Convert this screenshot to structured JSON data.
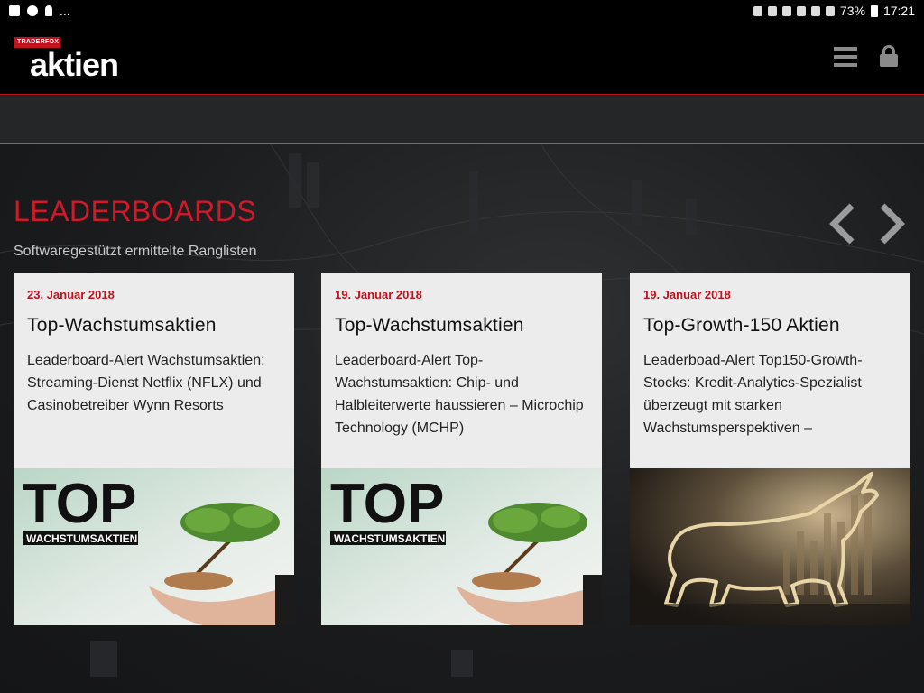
{
  "statusbar": {
    "left_more": "...",
    "battery_percent": "73%",
    "time": "17:21"
  },
  "header": {
    "brand_badge": "TRADERFOX",
    "brand_name": "aktien"
  },
  "section": {
    "title": "LEADERBOARDS",
    "subtitle": "Softwaregestützt ermittelte Ranglisten"
  },
  "cards": [
    {
      "date": "23. Januar 2018",
      "title": "Top-Wachstumsaktien",
      "text": "Leaderboard-Alert Wachstumsaktien: Streaming-Dienst Netflix (NFLX) und Casinobetreiber Wynn Resorts",
      "image_headline": "TOP",
      "image_subline": "WACHSTUMSAKTIEN"
    },
    {
      "date": "19. Januar 2018",
      "title": "Top-Wachstumsaktien",
      "text": "Leaderboard-Alert Top-Wachstumsaktien: Chip- und Halbleiterwerte haussieren – Microchip Technology (MCHP)",
      "image_headline": "TOP",
      "image_subline": "WACHSTUMSAKTIEN"
    },
    {
      "date": "19. Januar 2018",
      "title": "Top-Growth-150 Aktien",
      "text": "Leaderboad-Alert Top150-Growth-Stocks: Kredit-Analytics-Spezialist überzeugt mit starken Wachstumsperspektiven –"
    }
  ],
  "colors": {
    "accent": "#d0192b",
    "header_bg": "#000000",
    "card_bg": "#ececec"
  },
  "icons": {
    "menu": "hamburger-menu-icon",
    "lock": "lock-icon",
    "prev": "chevron-left-icon",
    "next": "chevron-right-icon"
  }
}
